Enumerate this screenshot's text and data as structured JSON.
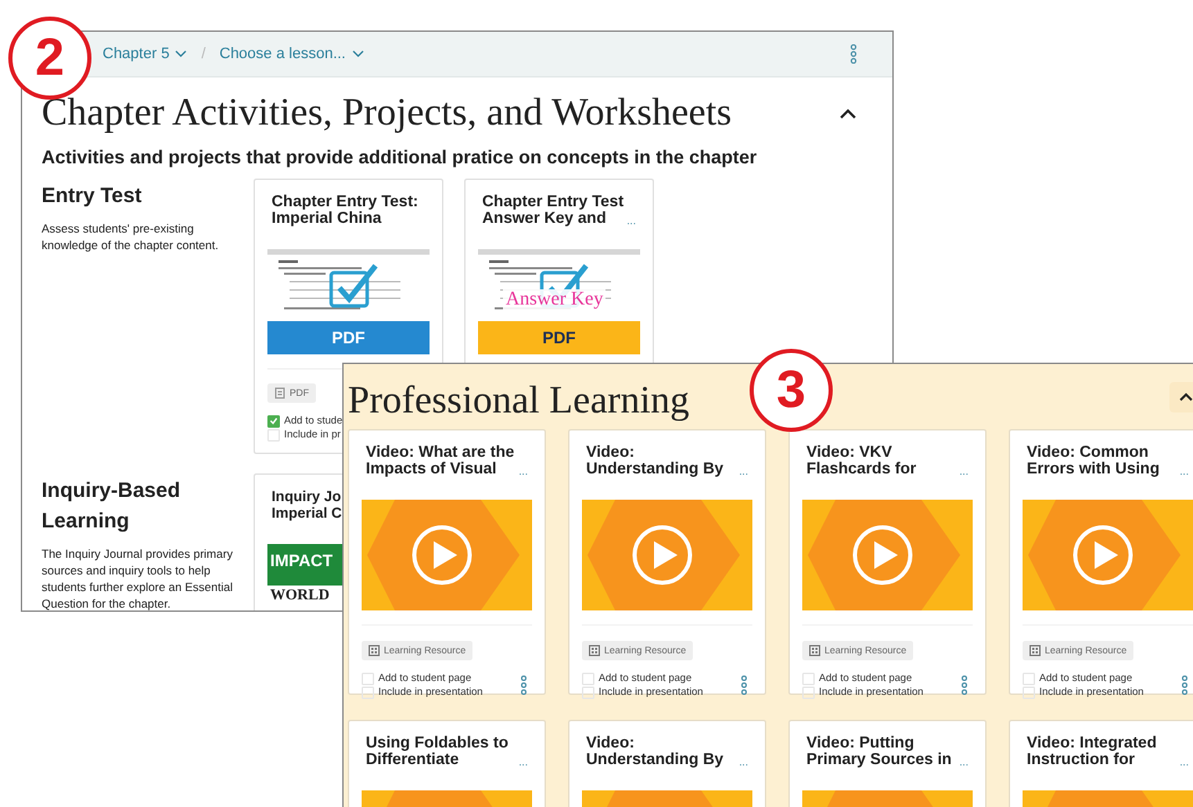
{
  "chapter_window": {
    "callout": "2",
    "breadcrumb": [
      {
        "label": "Chapter 5"
      },
      {
        "label": "Choose a lesson..."
      }
    ],
    "separator": "/",
    "title": "Chapter Activities, Projects, and Worksheets",
    "subtitle": "Activities and projects that provide additional pratice on concepts in the chapter",
    "sections": [
      {
        "heading": "Entry Test",
        "description": "Assess students' pre-existing knowledge of the chapter content.",
        "cards": [
          {
            "title_lines": [
              "Chapter Entry Test:",
              "Imperial China"
            ],
            "thumbnail": {
              "kind": "worksheet",
              "label": "PDF"
            },
            "tag": "PDF",
            "options": [
              {
                "label": "Add to stude",
                "checked": true
              },
              {
                "label": "Include in pr",
                "checked": false
              }
            ]
          },
          {
            "title_lines": [
              "Chapter Entry Test",
              "Answer Key and"
            ],
            "more": "...",
            "thumbnail": {
              "kind": "answer_key",
              "overlay": "Answer Key",
              "label": "PDF"
            }
          }
        ]
      },
      {
        "heading": "Inquiry-Based Learning",
        "description": "The Inquiry Journal provides primary sources and inquiry tools to help students further explore an Essential Question for the chapter.",
        "cards": [
          {
            "title_lines": [
              "Inquiry Jo",
              "Imperial C"
            ],
            "thumbnail": {
              "kind": "cover",
              "lines": [
                "IMPACT",
                "WORLD"
              ]
            }
          }
        ]
      }
    ]
  },
  "learning_window": {
    "callout": "3",
    "title": "Professional Learning",
    "cards": [
      {
        "title_lines": [
          "Video: What are the",
          "Impacts of Visual"
        ],
        "more": "...",
        "tag": "Learning Resource",
        "options": [
          {
            "label": "Add to student page",
            "checked": false
          },
          {
            "label": "Include in presentation",
            "checked": false
          }
        ]
      },
      {
        "title_lines": [
          "Video:",
          "Understanding By"
        ],
        "more": "...",
        "tag": "Learning Resource",
        "options": [
          {
            "label": "Add to student page",
            "checked": false
          },
          {
            "label": "Include in presentation",
            "checked": false
          }
        ]
      },
      {
        "title_lines": [
          "Video: VKV",
          "Flashcards for"
        ],
        "more": "...",
        "tag": "Learning Resource",
        "options": [
          {
            "label": "Add to student page",
            "checked": false
          },
          {
            "label": "Include in presentation",
            "checked": false
          }
        ]
      },
      {
        "title_lines": [
          "Video: Common",
          "Errors with Using"
        ],
        "more": "...",
        "tag": "Learning Resource",
        "options": [
          {
            "label": "Add to student page",
            "checked": false
          },
          {
            "label": "Include in presentation",
            "checked": false
          }
        ]
      },
      {
        "title_lines": [
          "Using Foldables to",
          "Differentiate"
        ],
        "more": "..."
      },
      {
        "title_lines": [
          "Video:",
          "Understanding By"
        ],
        "more": "..."
      },
      {
        "title_lines": [
          "Video: Putting",
          "Primary Sources in"
        ],
        "more": "..."
      },
      {
        "title_lines": [
          "Video: Integrated",
          "Instruction for"
        ],
        "more": "..."
      }
    ]
  }
}
